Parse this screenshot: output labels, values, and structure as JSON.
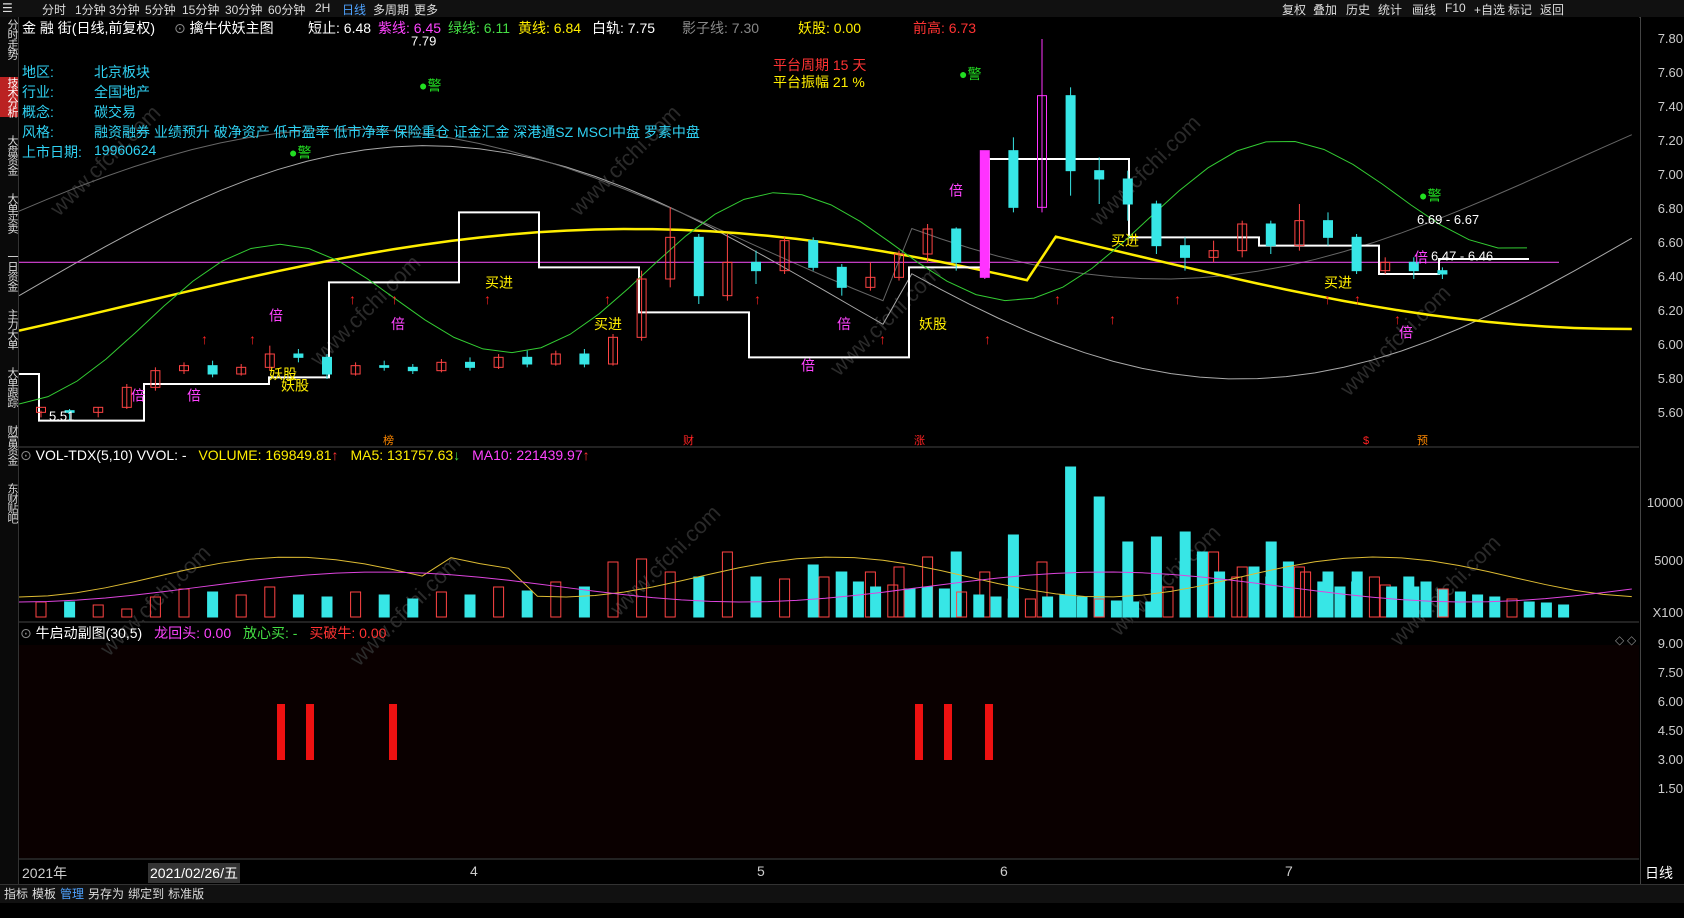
{
  "topbar": {
    "items": [
      "分时",
      "1分钟",
      "3分钟",
      "5分钟",
      "15分钟",
      "30分钟",
      "60分钟",
      "2H",
      "日线",
      "多周期",
      "更多"
    ],
    "active": "日线",
    "right_items": [
      "复权",
      "叠加",
      "历史",
      "统计",
      "画线",
      "F10",
      "+自选",
      "标记",
      "返回"
    ]
  },
  "left_tabs": [
    "分时走势",
    "技术分析",
    "大盘资金",
    "大单买卖",
    "一日资金",
    "主力大单",
    "大单跟踪",
    "财富资金",
    "东财贴吧"
  ],
  "left_active": 1,
  "main": {
    "title": "金 融 街(日线,前复权)",
    "indicator": "擒牛伏妖主图",
    "values": [
      {
        "label": "短止:",
        "value": "6.48",
        "color": "#ffffff"
      },
      {
        "label": "紫线:",
        "value": "6.45",
        "color": "#ff44ff"
      },
      {
        "label": "绿线:",
        "value": "6.11",
        "color": "#44dd44"
      },
      {
        "label": "黄线:",
        "value": "6.84",
        "color": "#ffee00"
      },
      {
        "label": "白轨:",
        "value": "7.75",
        "color": "#ffffff"
      },
      {
        "label": "影子线:",
        "value": "7.30",
        "color": "#888888"
      },
      {
        "label": "妖股:",
        "value": "0.00",
        "color": "#ffee00"
      },
      {
        "label": "前高:",
        "value": "6.73",
        "color": "#ff3333"
      }
    ],
    "stock_info": [
      {
        "label": "地区:",
        "value": "北京板块"
      },
      {
        "label": "行业:",
        "value": "全国地产"
      },
      {
        "label": "概念:",
        "value": "碳交易"
      },
      {
        "label": "风格:",
        "value": "融资融券 业绩预升 破净资产 低市盈率 低市净率 保险重仓 证金汇金 深港通SZ MSCI中盘 罗素中盘"
      },
      {
        "label": "上市日期:",
        "value": "19960624"
      }
    ],
    "platform": {
      "period": "平台周期 15 天",
      "amplitude": "平台振幅 21 %"
    },
    "high_label": "7.79",
    "low_label": "5.51",
    "line_labels": [
      "6.69 - 6.67",
      "6.47 - 6.46"
    ],
    "watermark": "www.cfchi.com",
    "bottom_marks": [
      "榜",
      "财",
      "涨",
      "$",
      "预"
    ],
    "chart_labels": {
      "buy": "买进",
      "double": "倍",
      "warn": "警",
      "demon": "妖股"
    }
  },
  "volume": {
    "title": "VOL-TDX(5,10)",
    "vvol": "VVOL: -",
    "vol": "VOLUME: 169849.81",
    "ma5": "MA5: 131757.63",
    "ma10": "MA10: 221439.97",
    "unit": "X100"
  },
  "sub": {
    "title": "牛启动副图(30,5)",
    "v1": "龙回头: 0.00",
    "v2": "放心买: -",
    "v3": "买破牛: 0.00"
  },
  "axis": {
    "price_ticks": [
      "7.80",
      "7.60",
      "7.40",
      "7.20",
      "7.00",
      "6.80",
      "6.60",
      "6.40",
      "6.20",
      "6.00",
      "5.80",
      "5.60"
    ],
    "vol_ticks": [
      "10000",
      "5000"
    ],
    "sub_ticks": [
      "9.00",
      "7.50",
      "6.00",
      "4.50",
      "3.00",
      "1.50"
    ]
  },
  "dates": {
    "year": "2021年",
    "cursor": "2021/02/26/五",
    "months": [
      "4",
      "5",
      "6",
      "7"
    ],
    "period": "日线"
  },
  "bottombar": {
    "items": [
      "指标",
      "模板",
      "管理",
      "另存为",
      "绑定到",
      "标准版"
    ],
    "active": "管理"
  },
  "chart_data": {
    "type": "candlestick",
    "candles": [
      [
        5.55,
        5.58,
        5.52,
        5.56
      ],
      [
        5.56,
        5.55,
        5.5,
        5.57
      ],
      [
        5.55,
        5.58,
        5.52,
        5.58
      ],
      [
        5.58,
        5.7,
        5.57,
        5.72
      ],
      [
        5.7,
        5.8,
        5.68,
        5.82
      ],
      [
        5.8,
        5.83,
        5.78,
        5.85
      ],
      [
        5.83,
        5.78,
        5.76,
        5.86
      ],
      [
        5.78,
        5.82,
        5.77,
        5.84
      ],
      [
        5.82,
        5.9,
        5.8,
        5.95
      ],
      [
        5.9,
        5.88,
        5.85,
        5.93
      ],
      [
        5.88,
        5.78,
        5.75,
        5.9
      ],
      [
        5.78,
        5.83,
        5.77,
        5.85
      ],
      [
        5.83,
        5.82,
        5.8,
        5.86
      ],
      [
        5.82,
        5.8,
        5.78,
        5.84
      ],
      [
        5.8,
        5.85,
        5.79,
        5.87
      ],
      [
        5.85,
        5.82,
        5.8,
        5.88
      ],
      [
        5.82,
        5.88,
        5.81,
        5.9
      ],
      [
        5.88,
        5.84,
        5.82,
        5.92
      ],
      [
        5.84,
        5.9,
        5.83,
        5.92
      ],
      [
        5.9,
        5.84,
        5.82,
        5.93
      ],
      [
        5.84,
        6.0,
        5.83,
        6.02
      ],
      [
        6.0,
        6.35,
        5.98,
        6.4
      ],
      [
        6.35,
        6.6,
        6.3,
        6.78
      ],
      [
        6.6,
        6.25,
        6.2,
        6.62
      ],
      [
        6.25,
        6.45,
        6.22,
        6.62
      ],
      [
        6.45,
        6.4,
        6.32,
        6.52
      ],
      [
        6.4,
        6.58,
        6.38,
        6.6
      ],
      [
        6.58,
        6.42,
        6.4,
        6.6
      ],
      [
        6.42,
        6.3,
        6.25,
        6.44
      ],
      [
        6.3,
        6.36,
        6.28,
        6.45
      ],
      [
        6.36,
        6.5,
        6.34,
        6.52
      ],
      [
        6.5,
        6.65,
        6.45,
        6.68
      ],
      [
        6.65,
        6.45,
        6.4,
        6.66
      ],
      [
        6.36,
        7.12,
        6.35,
        7.12
      ],
      [
        7.12,
        6.78,
        6.75,
        7.2
      ],
      [
        6.78,
        7.45,
        6.75,
        7.79
      ],
      [
        7.45,
        7.0,
        6.85,
        7.5
      ],
      [
        7.0,
        6.95,
        6.8,
        7.08
      ],
      [
        6.95,
        6.8,
        6.7,
        7.0
      ],
      [
        6.8,
        6.55,
        6.5,
        6.82
      ],
      [
        6.55,
        6.48,
        6.4,
        6.6
      ],
      [
        6.48,
        6.52,
        6.45,
        6.58
      ],
      [
        6.52,
        6.68,
        6.48,
        6.7
      ],
      [
        6.68,
        6.55,
        6.5,
        6.7
      ],
      [
        6.55,
        6.7,
        6.52,
        6.8
      ],
      [
        6.7,
        6.6,
        6.55,
        6.75
      ],
      [
        6.6,
        6.4,
        6.38,
        6.62
      ],
      [
        6.4,
        6.45,
        6.38,
        6.48
      ],
      [
        6.45,
        6.4,
        6.35,
        6.48
      ],
      [
        6.4,
        6.38,
        6.35,
        6.42
      ]
    ]
  }
}
